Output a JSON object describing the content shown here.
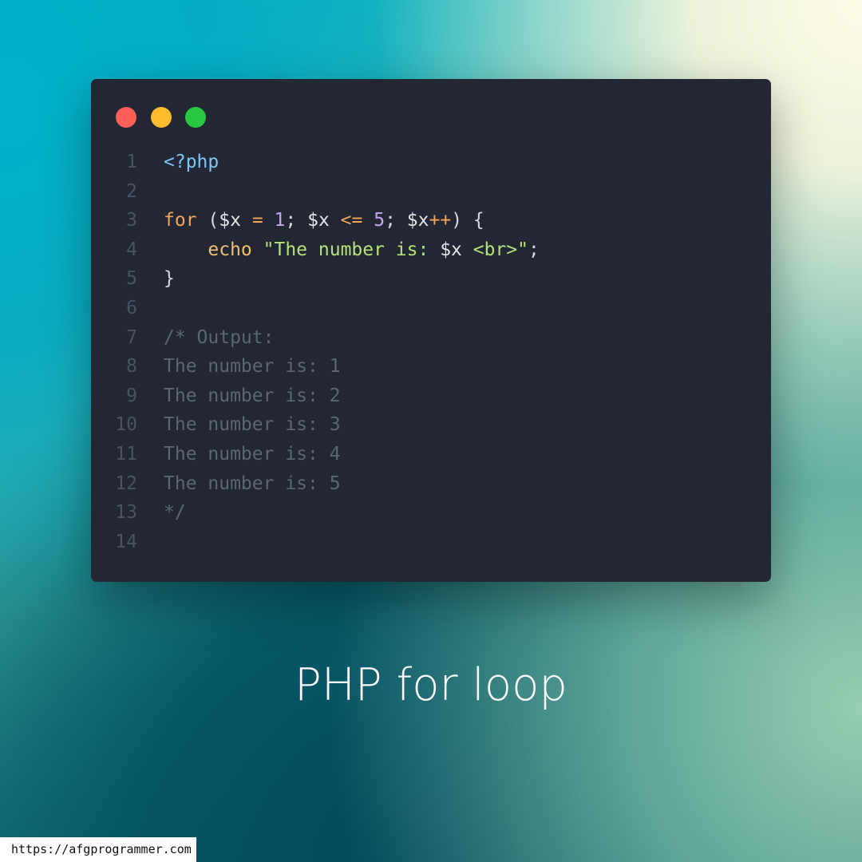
{
  "window": {
    "buttons": [
      "close",
      "minimize",
      "maximize"
    ],
    "colors": {
      "background": "#222733",
      "close": "#ff5f57",
      "minimize": "#febc2e",
      "maximize": "#28c840"
    }
  },
  "code": {
    "language": "php",
    "line_numbers": [
      "1",
      "2",
      "3",
      "4",
      "5",
      "6",
      "7",
      "8",
      "9",
      "10",
      "11",
      "12",
      "13",
      "14"
    ],
    "lines": [
      [
        {
          "text": "<?php",
          "type": "tag"
        }
      ],
      [],
      [
        {
          "text": "for",
          "type": "kw"
        },
        {
          "text": " (",
          "type": "punc"
        },
        {
          "text": "$x",
          "type": "var"
        },
        {
          "text": " ",
          "type": "punc"
        },
        {
          "text": "=",
          "type": "op"
        },
        {
          "text": " ",
          "type": "punc"
        },
        {
          "text": "1",
          "type": "num"
        },
        {
          "text": "; ",
          "type": "punc"
        },
        {
          "text": "$x",
          "type": "var"
        },
        {
          "text": " ",
          "type": "punc"
        },
        {
          "text": "<=",
          "type": "op"
        },
        {
          "text": " ",
          "type": "punc"
        },
        {
          "text": "5",
          "type": "num"
        },
        {
          "text": "; ",
          "type": "punc"
        },
        {
          "text": "$x",
          "type": "var"
        },
        {
          "text": "++",
          "type": "op"
        },
        {
          "text": ") {",
          "type": "punc"
        }
      ],
      [
        {
          "text": "    ",
          "type": "punc"
        },
        {
          "text": "echo",
          "type": "fn"
        },
        {
          "text": " ",
          "type": "punc"
        },
        {
          "text": "\"The number is: ",
          "type": "str"
        },
        {
          "text": "$x",
          "type": "strvar"
        },
        {
          "text": " <br>\"",
          "type": "str"
        },
        {
          "text": ";",
          "type": "punc"
        }
      ],
      [
        {
          "text": "}",
          "type": "punc"
        }
      ],
      [],
      [
        {
          "text": "/* Output:",
          "type": "com"
        }
      ],
      [
        {
          "text": "The number is: 1",
          "type": "com"
        }
      ],
      [
        {
          "text": "The number is: 2",
          "type": "com"
        }
      ],
      [
        {
          "text": "The number is: 3",
          "type": "com"
        }
      ],
      [
        {
          "text": "The number is: 4",
          "type": "com"
        }
      ],
      [
        {
          "text": "The number is: 5",
          "type": "com"
        }
      ],
      [
        {
          "text": "*/",
          "type": "com"
        }
      ],
      []
    ]
  },
  "caption": "PHP for loop",
  "watermark_url": "https://afgprogrammer.com"
}
